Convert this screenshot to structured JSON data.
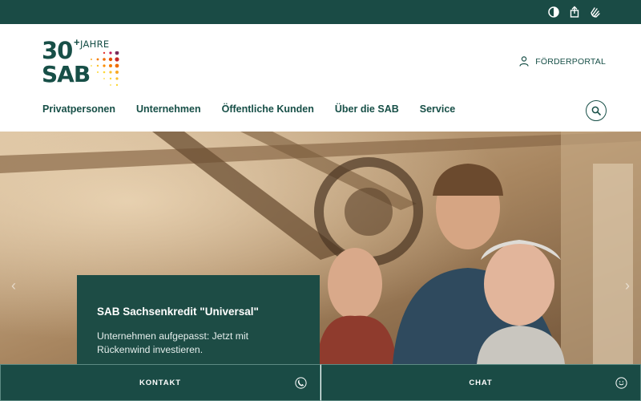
{
  "topbar": {
    "icons": [
      "contrast-icon",
      "share-icon",
      "sign-language-icon"
    ]
  },
  "logo": {
    "number": "30",
    "plus": "+",
    "jahre": "JAHRE",
    "brand": "SAB"
  },
  "portal": {
    "label": "FÖRDERPORTAL",
    "icon": "user-icon"
  },
  "nav": {
    "items": [
      "Privatpersonen",
      "Unternehmen",
      "Öffentliche Kunden",
      "Über die SAB",
      "Service"
    ]
  },
  "search": {
    "icon": "search-icon"
  },
  "hero": {
    "teaser_title": "SAB Sachsenkredit \"Universal\"",
    "teaser_text": "Unternehmen aufgepasst: Jetzt mit Rückenwind investieren.",
    "arrow_prev": "‹",
    "arrow_next": "›"
  },
  "bottombar": {
    "contact_label": "KONTAKT",
    "chat_label": "CHAT"
  },
  "colors": {
    "brand": "#1a4b45",
    "text": "#174f47",
    "white": "#ffffff"
  }
}
